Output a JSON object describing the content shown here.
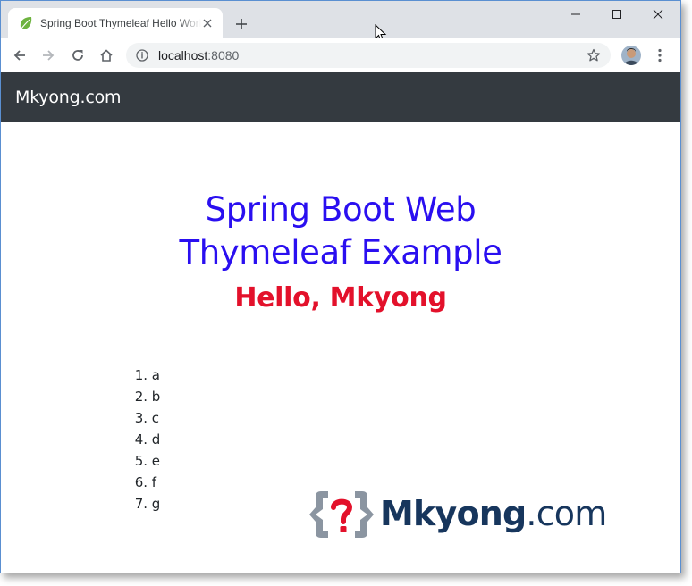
{
  "browser": {
    "tab_title": "Spring Boot Thymeleaf Hello World",
    "url_host": "localhost",
    "url_port": ":8080"
  },
  "page": {
    "brand": "Mkyong.com",
    "heading_line1": "Spring Boot Web",
    "heading_line2": "Thymeleaf Example",
    "greeting": "Hello, Mkyong",
    "list": [
      {
        "num": "1.",
        "text": "a"
      },
      {
        "num": "2.",
        "text": "b"
      },
      {
        "num": "3.",
        "text": "c"
      },
      {
        "num": "4.",
        "text": "d"
      },
      {
        "num": "5.",
        "text": "e"
      },
      {
        "num": "6.",
        "text": "f"
      },
      {
        "num": "7.",
        "text": "g"
      }
    ],
    "logo": {
      "bold": "Mkyong",
      "suffix": ".com"
    }
  },
  "colors": {
    "navbar": "#343a40",
    "heading": "#2a0ff0",
    "greeting": "#e3112b",
    "logo_text": "#17365d",
    "logo_mark": "#8b95a1",
    "logo_question": "#e3112b"
  },
  "icons": {
    "tab_favicon": "spring-leaf-icon",
    "tab_close": "close-icon",
    "new_tab": "plus-icon",
    "back": "arrow-left-icon",
    "forward": "arrow-right-icon",
    "reload": "reload-icon",
    "home": "home-icon",
    "site_info": "info-icon",
    "bookmark": "star-icon",
    "menu": "kebab-menu-icon"
  }
}
